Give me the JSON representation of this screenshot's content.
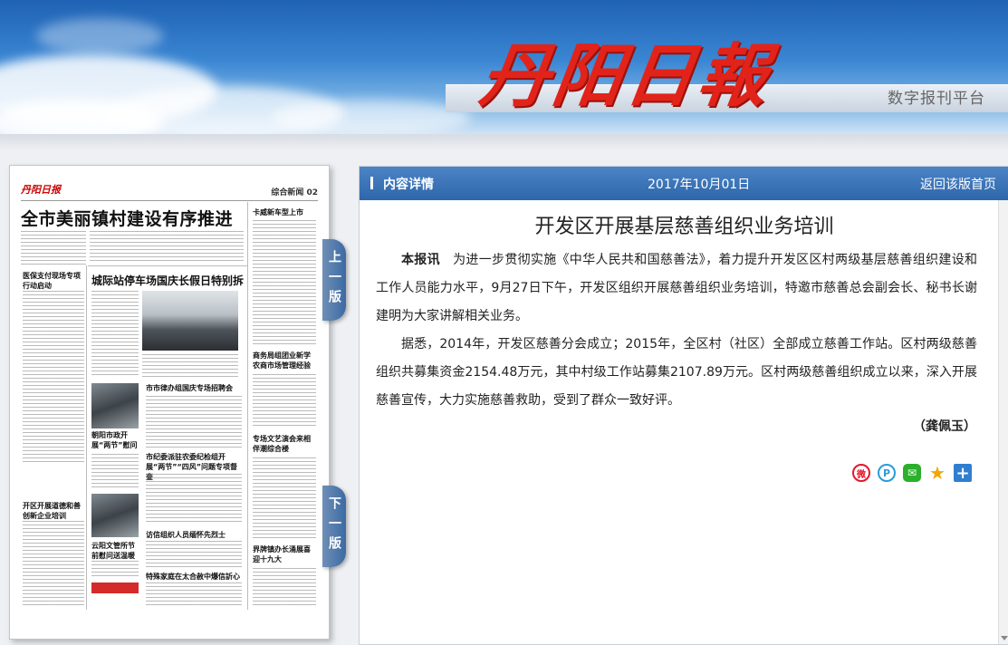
{
  "header": {
    "logo_text": "丹阳日報",
    "platform_label": "数字报刊平台"
  },
  "newspaper": {
    "masthead": "丹阳日报",
    "page_label": "综合新闻 02",
    "headline": "全市美丽镇村建设有序推进",
    "item_titles": [
      "医保支付现场专项行动启动",
      "城际站停车场国庆长假日特别拆",
      "市市律办组国庆专场招聘会",
      "朝阳市政开展“两节”慰问",
      "市纪委派驻农委纪检组开展“两节”“四风”问题专项督查",
      "开区开展道德和善创新企业培训",
      "云阳文管所节前慰问送温暖",
      "访信组织人员缅怀先烈士",
      "特殊家庭在太合赦中爆信訢心",
      "卡威新车型上市",
      "商务局组团业新学农商市场管理经验",
      "专场文艺演会来相伴潮综合楼",
      "界牌镇办长涌展喜迎十九大"
    ],
    "tab_prev": "上一版",
    "tab_next": "下一版"
  },
  "article": {
    "bar_label": "内容详情",
    "date": "2017年10月01日",
    "back_link": "返回该版首页",
    "title": "开发区开展基层慈善组织业务培训",
    "lead": "本报讯",
    "paragraph1": "为进一步贯彻实施《中华人民共和国慈善法》，着力提升开发区区村两级基层慈善组织建设和工作人员能力水平，9月27日下午，开发区组织开展慈善组织业务培训，特邀市慈善总会副会长、秘书长谢建明为大家讲解相关业务。",
    "paragraph2": "据悉，2014年，开发区慈善分会成立；2015年，全区村（社区）全部成立慈善工作站。区村两级慈善组织共募集资金2154.48万元，其中村级工作站募集2107.89万元。区村两级慈善组织成立以来，深入开展慈善宣传，大力实施慈善救助，受到了群众一致好评。",
    "author": "（龚佩玉）"
  },
  "share": {
    "icons": [
      "weibo-icon",
      "pengyou-icon",
      "wechat-icon",
      "qzone-icon",
      "more-share-icon"
    ]
  },
  "colors": {
    "bar": "#2d66aa",
    "logo_red": "#e2231a"
  }
}
